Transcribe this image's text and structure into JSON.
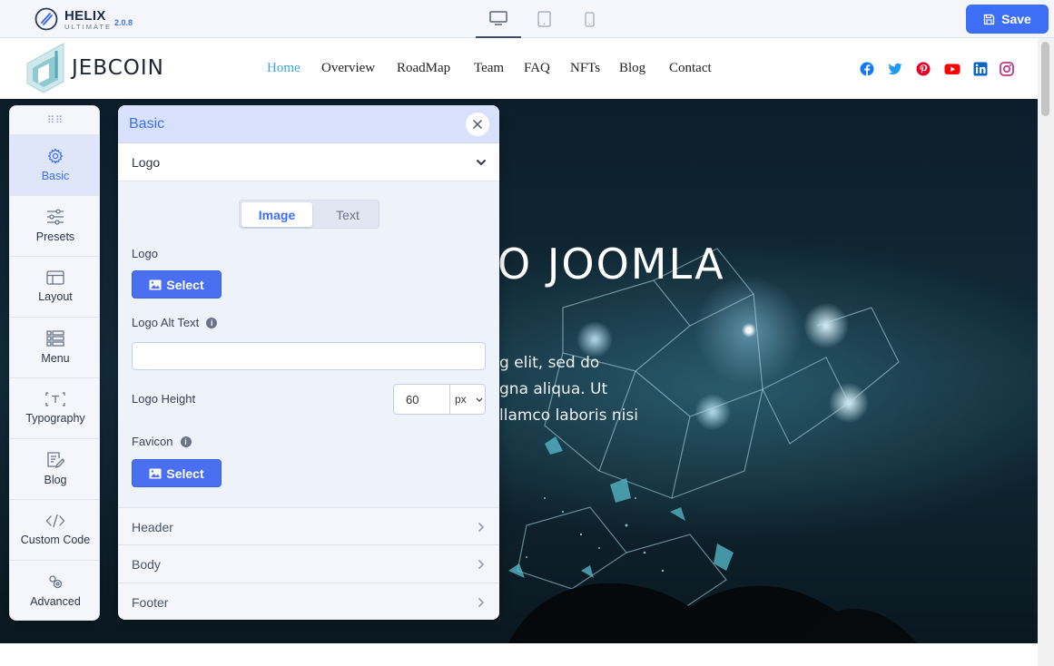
{
  "builder": {
    "brand": "HELIX",
    "brand_sub": "ULTIMATE",
    "version": "2.0.8",
    "devices": [
      "desktop-icon",
      "tablet-icon",
      "mobile-icon"
    ],
    "active_device": "desktop",
    "save_label": "Save",
    "accent": "#3d6ef7"
  },
  "site": {
    "logo_text": "JEBCOIN",
    "nav": [
      "Home",
      "Overview",
      "RoadMap",
      "Team",
      "FAQ",
      "NFTs",
      "Blog",
      "Contact"
    ],
    "active_nav": "Home",
    "social": [
      {
        "icon": "facebook-icon",
        "color": "#1877f2"
      },
      {
        "icon": "twitter-icon",
        "color": "#1d9bf0"
      },
      {
        "icon": "pinterest-icon",
        "color": "#e60023"
      },
      {
        "icon": "youtube-icon",
        "color": "#ff0000"
      },
      {
        "icon": "linkedin-icon",
        "color": "#0a66c2"
      },
      {
        "icon": "instagram-icon",
        "color": "#c13584"
      }
    ]
  },
  "hero": {
    "title": "O JOOMLA",
    "lines": [
      "g elit, sed do",
      "gna aliqua. Ut",
      "llamco laboris nisi"
    ]
  },
  "sidebar": {
    "items": [
      {
        "label": "Basic",
        "icon": "gear-icon"
      },
      {
        "label": "Presets",
        "icon": "sliders-icon"
      },
      {
        "label": "Layout",
        "icon": "layout-icon"
      },
      {
        "label": "Menu",
        "icon": "menu-list-icon"
      },
      {
        "label": "Typography",
        "icon": "typography-icon"
      },
      {
        "label": "Blog",
        "icon": "blog-edit-icon"
      },
      {
        "label": "Custom Code",
        "icon": "code-icon"
      },
      {
        "label": "Advanced",
        "icon": "advanced-icon"
      }
    ],
    "active": "Basic"
  },
  "panel": {
    "title": "Basic",
    "logo_section": {
      "title": "Logo",
      "tabs": [
        "Image",
        "Text"
      ],
      "active_tab": "Image",
      "logo_label": "Logo",
      "select_label": "Select",
      "alt_text_label": "Logo Alt Text",
      "alt_text_value": "",
      "height_label": "Logo Height",
      "height_value": "60",
      "height_unit": "px",
      "favicon_label": "Favicon"
    },
    "sections": [
      "Header",
      "Body",
      "Footer"
    ]
  }
}
